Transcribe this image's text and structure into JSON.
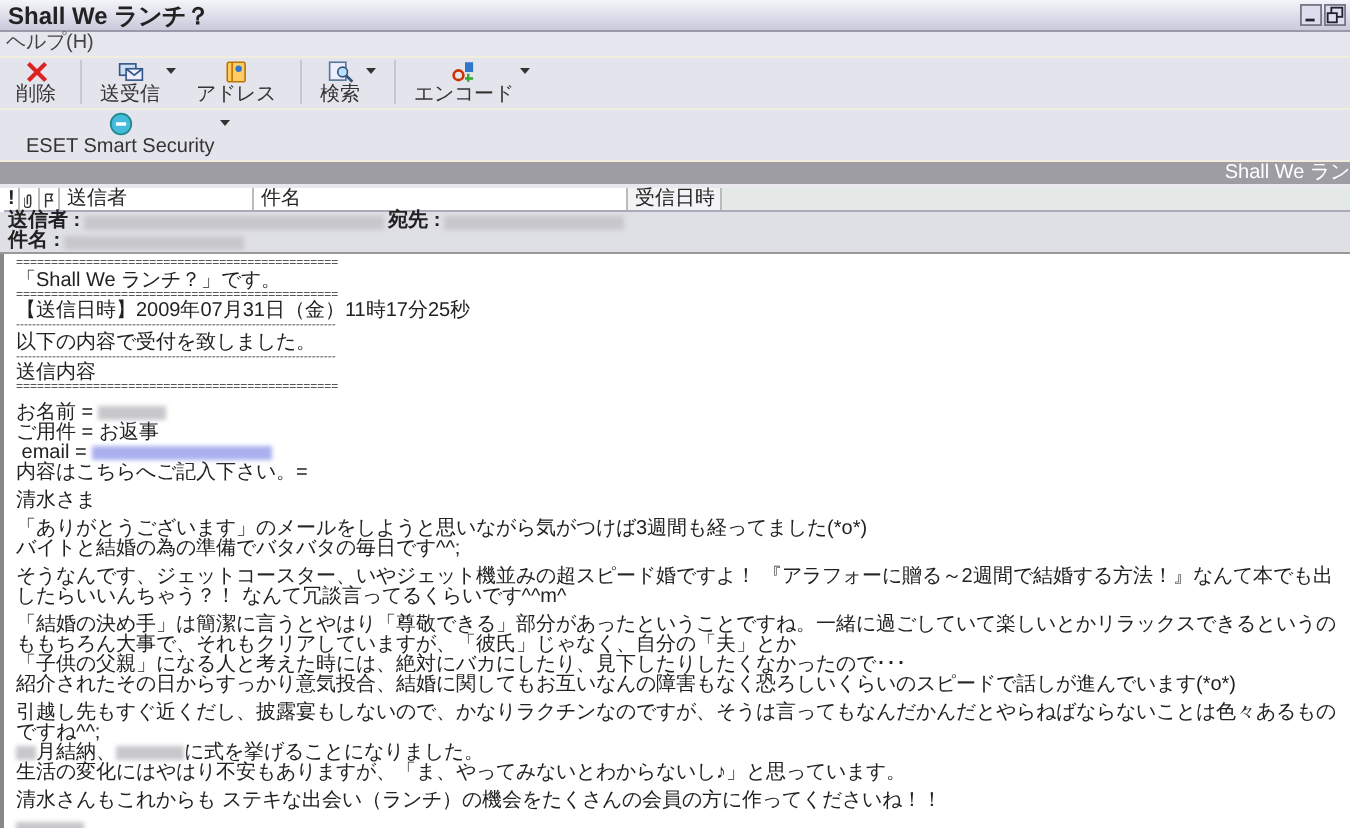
{
  "window": {
    "title": "Shall We ランチ？"
  },
  "menu": [
    "ヘルプ(H)"
  ],
  "toolbar": [
    {
      "label": "削除",
      "kind": "delete",
      "dropdown": false
    },
    {
      "label": "送受信",
      "kind": "sendreceive",
      "dropdown": true
    },
    {
      "label": "アドレス",
      "kind": "address",
      "dropdown": false
    },
    {
      "label": "検索",
      "kind": "find",
      "dropdown": true
    },
    {
      "label": "エンコード",
      "kind": "encode",
      "dropdown": true
    }
  ],
  "addon_toolbar": [
    {
      "label": "ESET Smart Security",
      "kind": "eset",
      "dropdown": true
    }
  ],
  "preview_title": "Shall We ラン",
  "message_list": {
    "columns": [
      {
        "kind": "priority",
        "label": "!"
      },
      {
        "kind": "attachment"
      },
      {
        "kind": "flag"
      },
      {
        "kind": "text",
        "label": "送信者",
        "sorted": false
      },
      {
        "kind": "text",
        "label": "件名",
        "sorted": false
      },
      {
        "kind": "text",
        "label": "受信日時",
        "sorted": true
      }
    ]
  },
  "header": {
    "rows": [
      [
        {
          "kind": "label",
          "text": "送信者 :"
        },
        {
          "kind": "redacted"
        },
        {
          "kind": "label",
          "text": "宛先 :"
        },
        {
          "kind": "redacted"
        }
      ],
      [
        {
          "kind": "label",
          "text": "件名 :"
        },
        {
          "kind": "redacted"
        }
      ]
    ]
  },
  "body": {
    "paragraphs": [
      [
        {
          "kind": "rule",
          "text": "=============================================="
        },
        {
          "kind": "text",
          "text": "「Shall We ランチ？」です。"
        },
        {
          "kind": "rule",
          "text": "=============================================="
        },
        {
          "kind": "text",
          "text": "【送信日時】2009年07月31日（金）11時17分25秒"
        },
        {
          "kind": "rule",
          "text": "--------------------------------------------------------------------------------"
        },
        {
          "kind": "text",
          "text": "以下の内容で受付を致しました。"
        },
        {
          "kind": "rule",
          "text": "--------------------------------------------------------------------------------"
        },
        {
          "kind": "text",
          "text": "送信内容"
        },
        {
          "kind": "rule",
          "text": "=============================================="
        }
      ],
      [
        {
          "kind": "mixed",
          "parts": [
            {
              "kind": "text",
              "text": "お名前 = "
            },
            {
              "kind": "redacted"
            }
          ]
        },
        {
          "kind": "text",
          "text": " ご用件 = お返事"
        },
        {
          "kind": "mixed",
          "parts": [
            {
              "kind": "text",
              "text": " email = "
            },
            {
              "kind": "redacted-link"
            }
          ]
        },
        {
          "kind": "text",
          "text": " 内容はこちらへご記入下さい。="
        }
      ],
      [
        {
          "kind": "text",
          "text": "清水さま"
        }
      ],
      [
        {
          "kind": "text",
          "text": "「ありがとうございます」のメールをしようと思いながら気がつけば3週間も経ってました(*o*)"
        },
        {
          "kind": "text",
          "text": "バイトと結婚の為の準備でバタバタの毎日です^^;"
        }
      ],
      [
        {
          "kind": "text",
          "text": "そうなんです、ジェットコースター、いやジェット機並みの超スピード婚ですよ！ 『アラフォーに贈る～2週間で結婚する方法！』なんて本でも出したらいいんちゃう？！ なんて冗談言ってるくらいです^^m^"
        }
      ],
      [
        {
          "kind": "text",
          "text": "「結婚の決め手」は簡潔に言うとやはり「尊敬できる」部分があったということですね。一緒に過ごしていて楽しいとかリラックスできるというのももちろん大事で、それもクリアしていますが、「彼氏」じゃなく、自分の「夫」とか"
        },
        {
          "kind": "text",
          "text": "「子供の父親」になる人と考えた時には、絶対にバカにしたり、見下したりしたくなかったので･･･"
        },
        {
          "kind": "text",
          "text": "紹介されたその日からすっかり意気投合、結婚に関してもお互いなんの障害もなく恐ろしいくらいのスピードで話しが進んでいます(*o*)"
        }
      ],
      [
        {
          "kind": "text",
          "text": "引越し先もすぐ近くだし、披露宴もしないので、かなりラクチンなのですが、そうは言ってもなんだかんだとやらねばならないことは色々あるものですね^^;"
        },
        {
          "kind": "mixed",
          "parts": [
            {
              "kind": "redacted"
            },
            {
              "kind": "text",
              "text": "月結納、"
            },
            {
              "kind": "redacted"
            },
            {
              "kind": "text",
              "text": "に式を挙げることになりました。"
            }
          ]
        },
        {
          "kind": "text",
          "text": "生活の変化にはやはり不安もありますが、「ま、やってみないとわからないし♪」と思っています。"
        }
      ],
      [
        {
          "kind": "text",
          "text": "清水さんもこれからも ステキな出会い（ランチ）の機会をたくさんの会員の方に作ってくださいね！！"
        }
      ],
      [
        {
          "kind": "mixed",
          "parts": [
            {
              "kind": "redacted"
            }
          ]
        }
      ]
    ]
  }
}
